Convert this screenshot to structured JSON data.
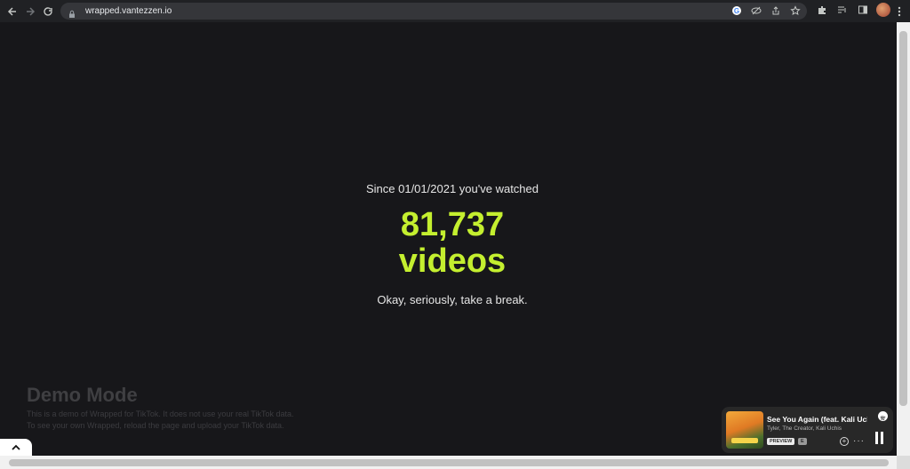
{
  "browser": {
    "url": "wrapped.vantezzen.io"
  },
  "main": {
    "since_text": "Since 01/01/2021 you've watched",
    "count": "81,737",
    "unit": "videos",
    "message": "Okay, seriously, take a break."
  },
  "demo": {
    "title": "Demo Mode",
    "line1": "This is a demo of Wrapped for TikTok. It does not use your real TikTok data.",
    "line2": "To see your own Wrapped, reload the page and upload your TikTok data."
  },
  "player": {
    "song": "See You Again (feat. Kali Uchis)",
    "artist": "Tyler, The Creator, Kali Uchis",
    "preview_label": "PREVIEW",
    "explicit_label": "E"
  },
  "colors": {
    "accent": "#c4ef2f",
    "background": "#17171a"
  }
}
